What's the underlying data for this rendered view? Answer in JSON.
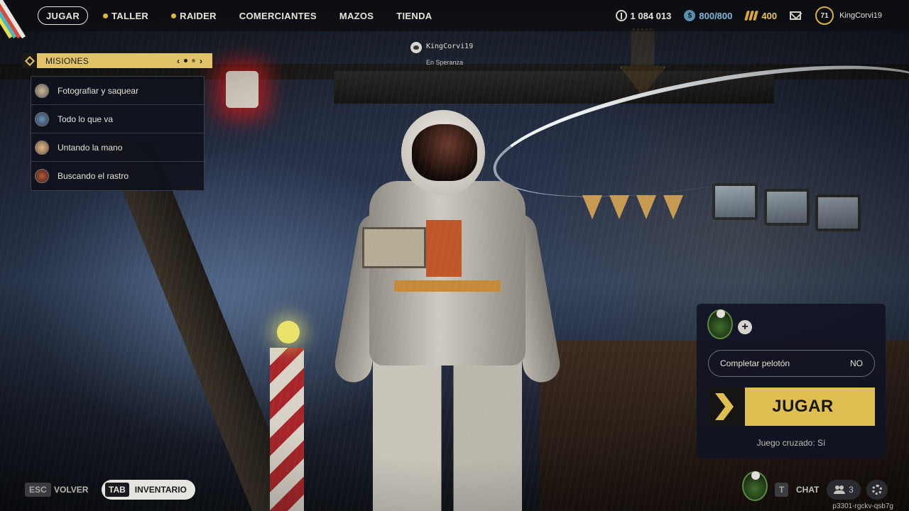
{
  "nav": {
    "items": [
      {
        "label": "JUGAR",
        "active": true,
        "dot": false
      },
      {
        "label": "TALLER",
        "active": false,
        "dot": true
      },
      {
        "label": "RAIDER",
        "active": false,
        "dot": true
      },
      {
        "label": "COMERCIANTES",
        "active": false,
        "dot": false
      },
      {
        "label": "MAZOS",
        "active": false,
        "dot": false
      },
      {
        "label": "TIENDA",
        "active": false,
        "dot": false
      }
    ]
  },
  "stats": {
    "coins": "1 084 013",
    "tokens": "800/800",
    "bars": "400",
    "level": "71",
    "username": "KingCorvi19"
  },
  "missions": {
    "title": "MISIONES",
    "prev": "‹",
    "next": "›",
    "page": 1,
    "pages": 3,
    "items": [
      {
        "label": "Fotografiar y saquear"
      },
      {
        "label": "Todo lo que va"
      },
      {
        "label": "Untando la mano"
      },
      {
        "label": "Buscando el rastro"
      }
    ]
  },
  "player_tag": {
    "name": "KingCorvi19",
    "location": "En Speranza"
  },
  "play_panel": {
    "add": "+",
    "fill_label": "Completar pelotón",
    "fill_value": "NO",
    "play_label": "JUGAR",
    "crossplay": "Juego cruzado: Sí"
  },
  "bottom": {
    "esc_key": "ESC",
    "esc_label": "VOLVER",
    "tab_key": "TAB",
    "tab_label": "INVENTARIO",
    "chat_key": "T",
    "chat_label": "CHAT",
    "friends_count": "3",
    "build": "p3301-rgckv-qsb7g"
  },
  "colors": {
    "accent": "#e0bf52",
    "panel": "#111322"
  }
}
